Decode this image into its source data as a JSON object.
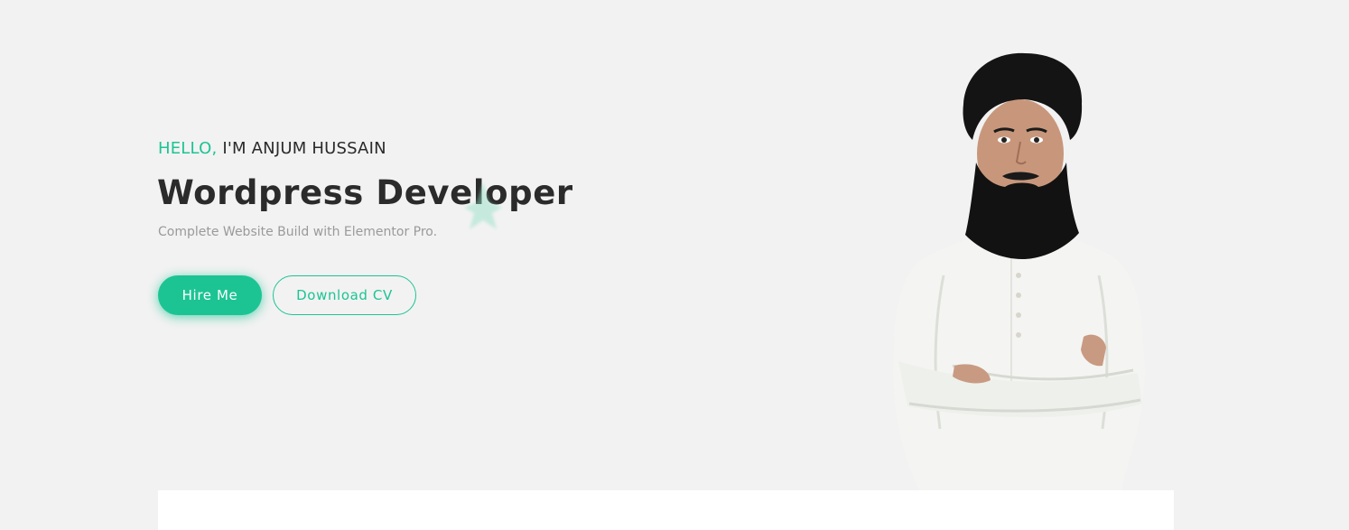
{
  "hero": {
    "greeting_hello": "HELLO,",
    "greeting_name": "I'M ANJUM HUSSAIN",
    "title": "Wordpress Developer",
    "subtitle": "Complete Website Build with Elementor Pro.",
    "buttons": {
      "hire_label": "Hire Me",
      "cv_label": "Download CV"
    },
    "portrait_icon": "person-photo-icon",
    "decoration_icon": "star-shape-icon"
  },
  "colors": {
    "accent": "#1cc494",
    "background": "#f2f2f2",
    "heading": "#2b2b2b",
    "muted": "#9a9a9a"
  }
}
